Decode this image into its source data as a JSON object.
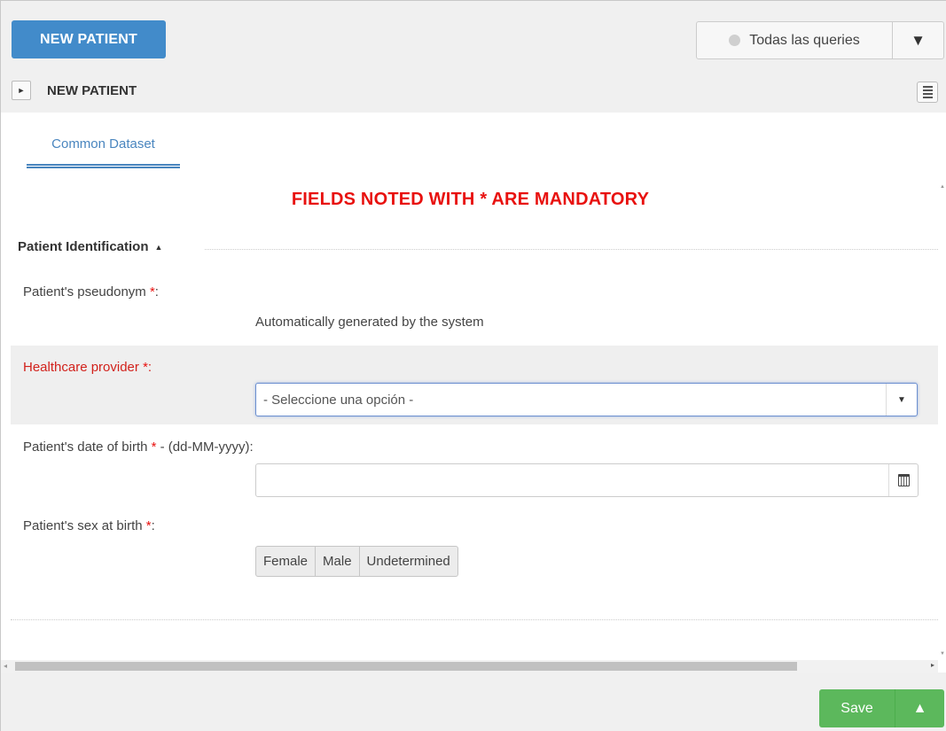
{
  "header": {
    "new_patient_button": "NEW PATIENT",
    "queries_label": "Todas las queries",
    "queries_caret": "▼"
  },
  "section": {
    "expand_glyph": "►",
    "title": "NEW PATIENT"
  },
  "tabs": [
    {
      "label": "Common Dataset",
      "active": true
    }
  ],
  "form": {
    "mandatory_notice": "FIELDS NOTED WITH * ARE MANDATORY",
    "group_title": "Patient Identification",
    "group_caret": "▲",
    "required_mark": "*",
    "pseudonym": {
      "label": "Patient's pseudonym ",
      "suffix": ":",
      "value": "Automatically generated by the system"
    },
    "provider": {
      "label": "Healthcare provider ",
      "suffix": ":",
      "selected": "- Seleccione una opción -",
      "arrow": "▼"
    },
    "dob": {
      "label": "Patient's date of birth ",
      "suffix": " - (dd-MM-yyyy):",
      "value": ""
    },
    "sex": {
      "label": "Patient's sex at birth ",
      "suffix": ":",
      "options": [
        "Female",
        "Male",
        "Undetermined"
      ]
    }
  },
  "scroll": {
    "left_arrow": "◂",
    "right_arrow": "▸",
    "up_arrow": "▲",
    "down_arrow": "▼"
  },
  "footer": {
    "save_button": "Save",
    "save_caret": "▲"
  },
  "colors": {
    "primary": "#428bca",
    "success": "#5cb85c",
    "required": "#e8110f",
    "tab_accent": "#4a86bf"
  }
}
